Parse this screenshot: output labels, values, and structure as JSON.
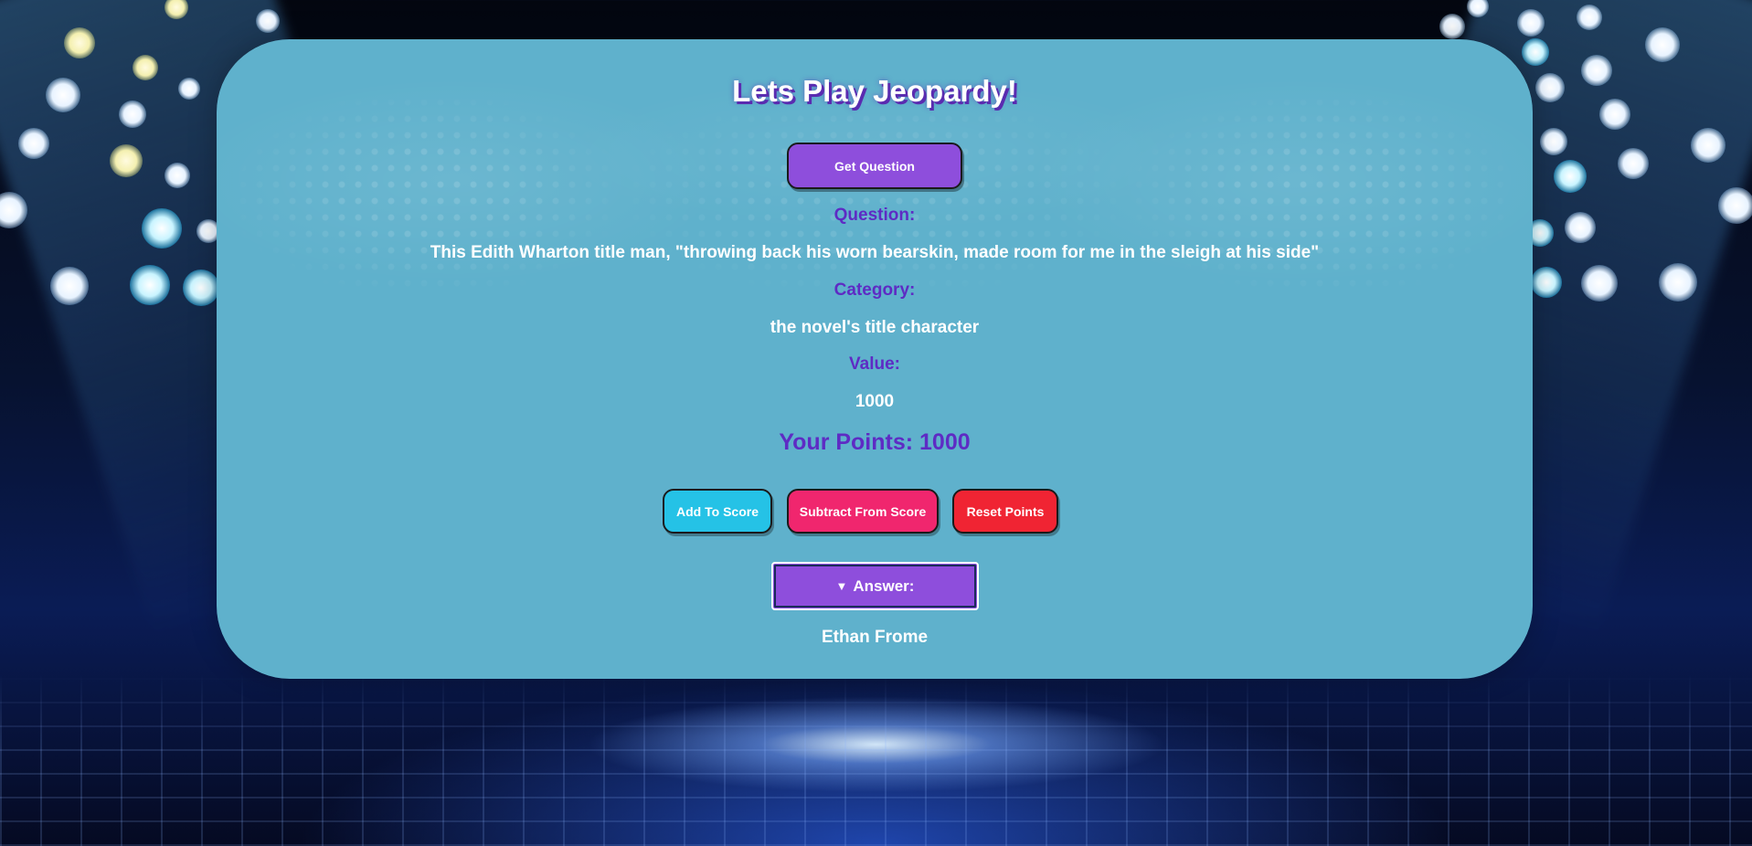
{
  "page": {
    "title": "Lets Play Jeopardy!"
  },
  "actions": {
    "get_question": "Get Question"
  },
  "question": {
    "label": "Question:",
    "text": "This Edith Wharton title man, \"throwing back his worn bearskin, made room for me in the sleigh at his side\""
  },
  "category": {
    "label": "Category:",
    "text": "the novel's title character"
  },
  "value": {
    "label": "Value:",
    "text": "1000"
  },
  "score": {
    "text": "Your Points: 1000"
  },
  "score_buttons": {
    "add": "Add To Score",
    "subtract": "Subtract From Score",
    "reset": "Reset Points"
  },
  "answer": {
    "toggle_icon": "▼",
    "toggle_label": "Answer:",
    "text": "Ethan Frome"
  },
  "colors": {
    "card": "#5fb1cc",
    "accent_purple": "#8e4edc",
    "label_purple": "#5e2bc4",
    "add_button": "#25c2e6",
    "subtract_button": "#f0266e",
    "reset_button": "#f02433"
  }
}
